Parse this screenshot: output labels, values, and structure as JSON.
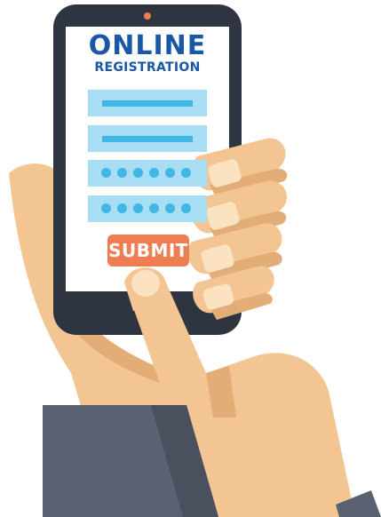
{
  "screen": {
    "title": "ONLINE",
    "subtitle": "REGISTRATION",
    "submit_label": "SUBMIT"
  },
  "form": {
    "fields": [
      {
        "name": "text-field-1",
        "type": "text"
      },
      {
        "name": "text-field-2",
        "type": "text"
      },
      {
        "name": "password-field-1",
        "type": "password",
        "masked_chars": 6
      },
      {
        "name": "password-field-2",
        "type": "password",
        "masked_chars": 6
      }
    ]
  },
  "colors": {
    "phone_body": "#2f3540",
    "screen_bg": "#ffffff",
    "title_blue": "#1a57a6",
    "field_bg": "#a8def4",
    "field_accent": "#3fb6e3",
    "submit_bg": "#ef7d52",
    "camera": "#ef7d52",
    "skin": "#f3c592",
    "skin_shadow": "#e3ad78",
    "nail": "#fbe3c1",
    "sleeve": "#5a6170"
  },
  "icons": {
    "illustration": "hand-holding-phone"
  }
}
